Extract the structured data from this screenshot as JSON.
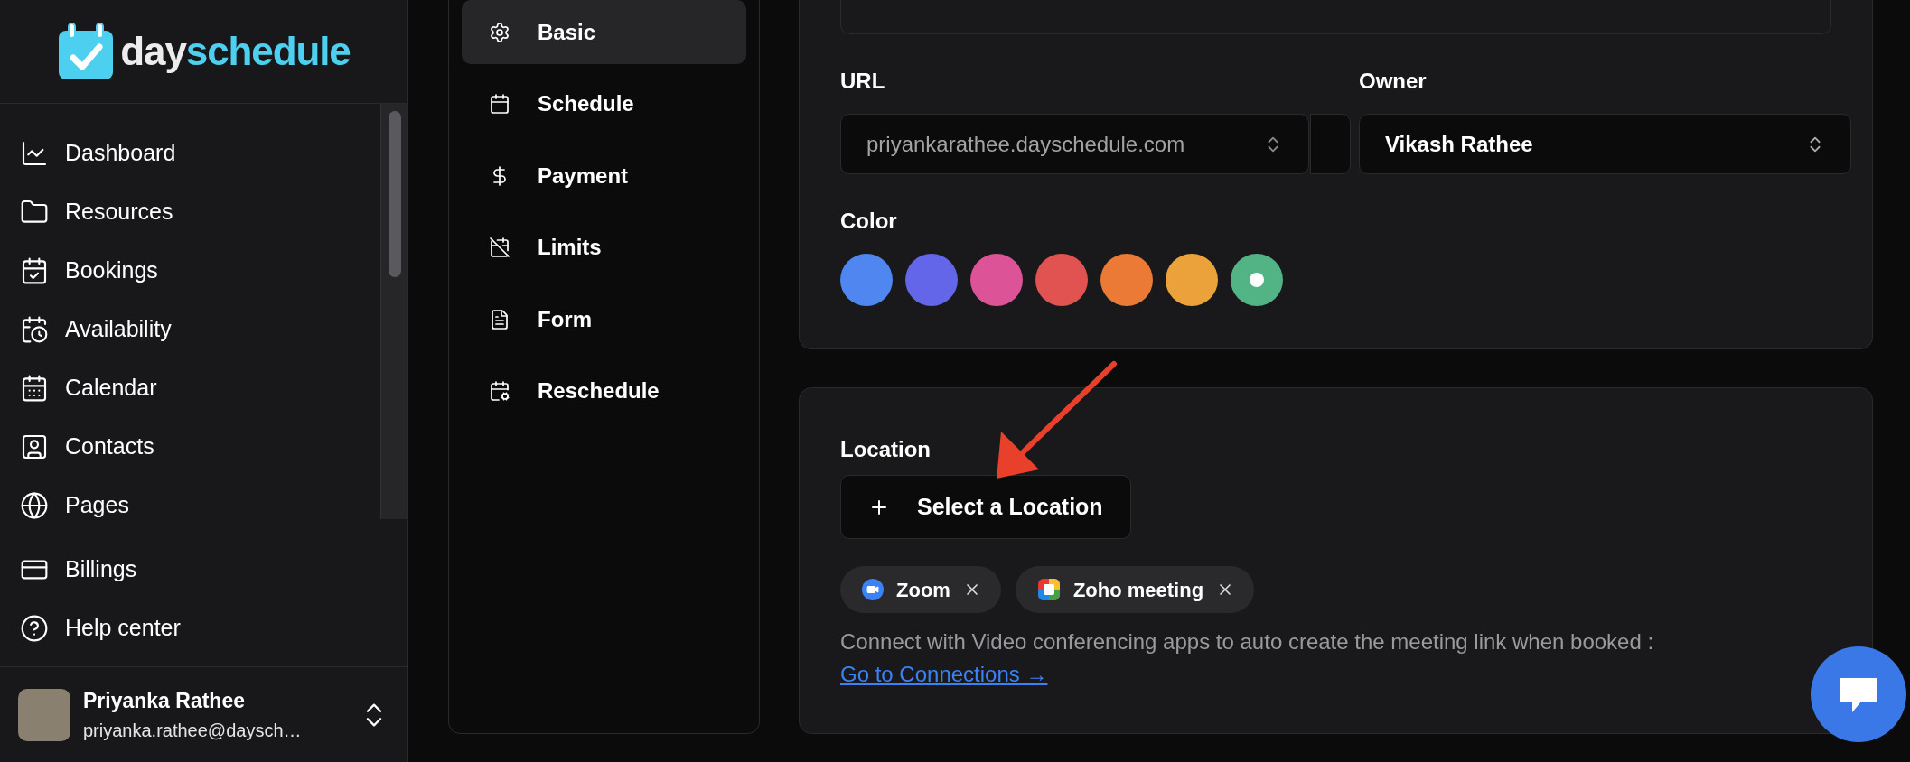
{
  "logo": {
    "part_1": "day",
    "part_2": "schedule"
  },
  "sidebar": {
    "items": [
      {
        "label": "Dashboard"
      },
      {
        "label": "Resources"
      },
      {
        "label": "Bookings"
      },
      {
        "label": "Availability"
      },
      {
        "label": "Calendar"
      },
      {
        "label": "Contacts"
      },
      {
        "label": "Pages"
      },
      {
        "label": "Billings"
      },
      {
        "label": "Help center"
      }
    ]
  },
  "user": {
    "name": "Priyanka Rathee",
    "email": "priyanka.rathee@daysch…"
  },
  "settings_nav": {
    "items": [
      {
        "label": "Basic",
        "selected": true
      },
      {
        "label": "Schedule",
        "selected": false
      },
      {
        "label": "Payment",
        "selected": false
      },
      {
        "label": "Limits",
        "selected": false
      },
      {
        "label": "Form",
        "selected": false
      },
      {
        "label": "Reschedule",
        "selected": false
      }
    ]
  },
  "form": {
    "url": {
      "label": "URL",
      "value": "priyankarathee.dayschedule.com"
    },
    "owner": {
      "label": "Owner",
      "value": "Vikash Rathee"
    },
    "color": {
      "label": "Color",
      "options": [
        {
          "color": "#4f86f0",
          "selected": false
        },
        {
          "color": "#6366e9",
          "selected": false
        },
        {
          "color": "#dc5497",
          "selected": false
        },
        {
          "color": "#e05350",
          "selected": false
        },
        {
          "color": "#ea7a35",
          "selected": false
        },
        {
          "color": "#eba23b",
          "selected": false
        },
        {
          "color": "#52b484",
          "selected": true
        }
      ]
    }
  },
  "location": {
    "label": "Location",
    "button": "Select a Location",
    "chips": [
      {
        "kind": "zoom",
        "label": "Zoom"
      },
      {
        "kind": "zoho",
        "label": "Zoho meeting"
      }
    ],
    "help_text": "Connect with Video conferencing apps to auto create the meeting link when booked : ",
    "link": "Go to Connections →"
  }
}
